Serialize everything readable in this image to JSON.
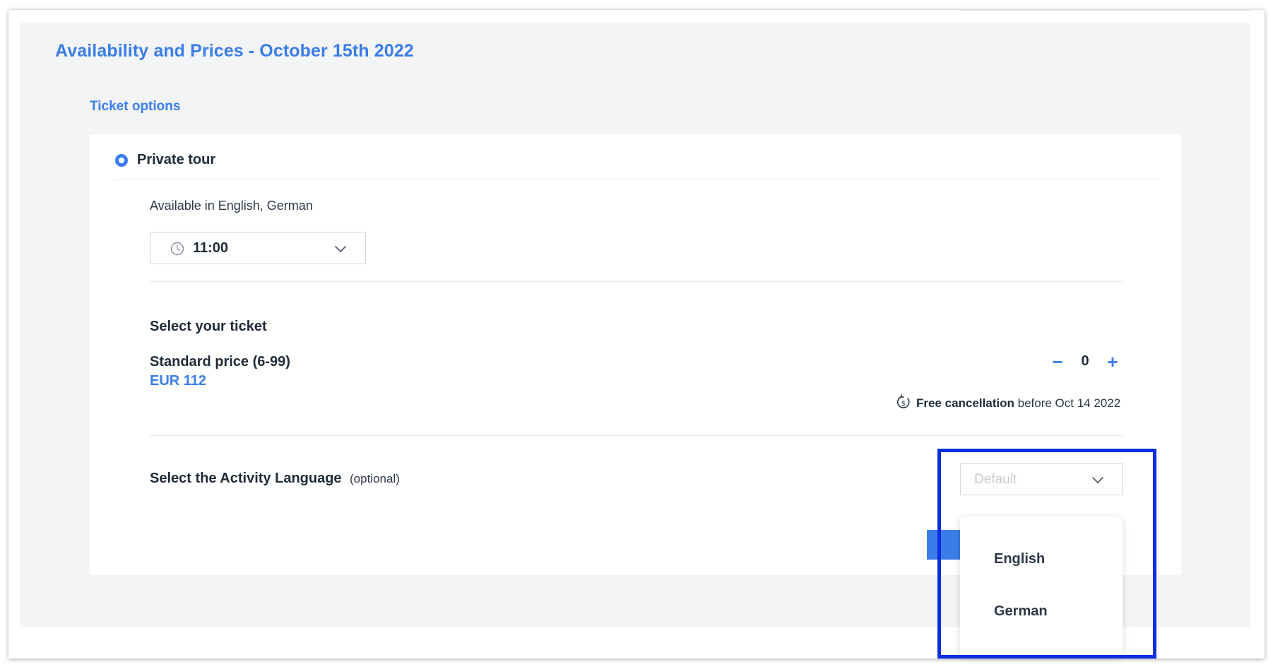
{
  "page": {
    "title": "Availability and Prices - October 15th 2022",
    "section_link": "Ticket options"
  },
  "option": {
    "title": "Private tour",
    "availability": "Available in English, German",
    "time_value": "11:00"
  },
  "ticket": {
    "heading": "Select your ticket",
    "price_name": "Standard price (6-99)",
    "price_value": "EUR 112",
    "minus_label": "−",
    "quantity": "0",
    "plus_label": "+",
    "cancel_bold": "Free cancellation",
    "cancel_rest": " before Oct 14 2022"
  },
  "language": {
    "label": "Select the Activity Language",
    "optional": "(optional)",
    "placeholder": "Default",
    "options": [
      "English",
      "German"
    ]
  },
  "colors": {
    "accent": "#3b7de8",
    "highlight": "#0a2fe0",
    "panel_bg": "#f3f4f6"
  },
  "icons": {
    "time": "clock-icon",
    "cancellation": "refund-clock-icon",
    "dropdown": "chevron-down-icon"
  }
}
